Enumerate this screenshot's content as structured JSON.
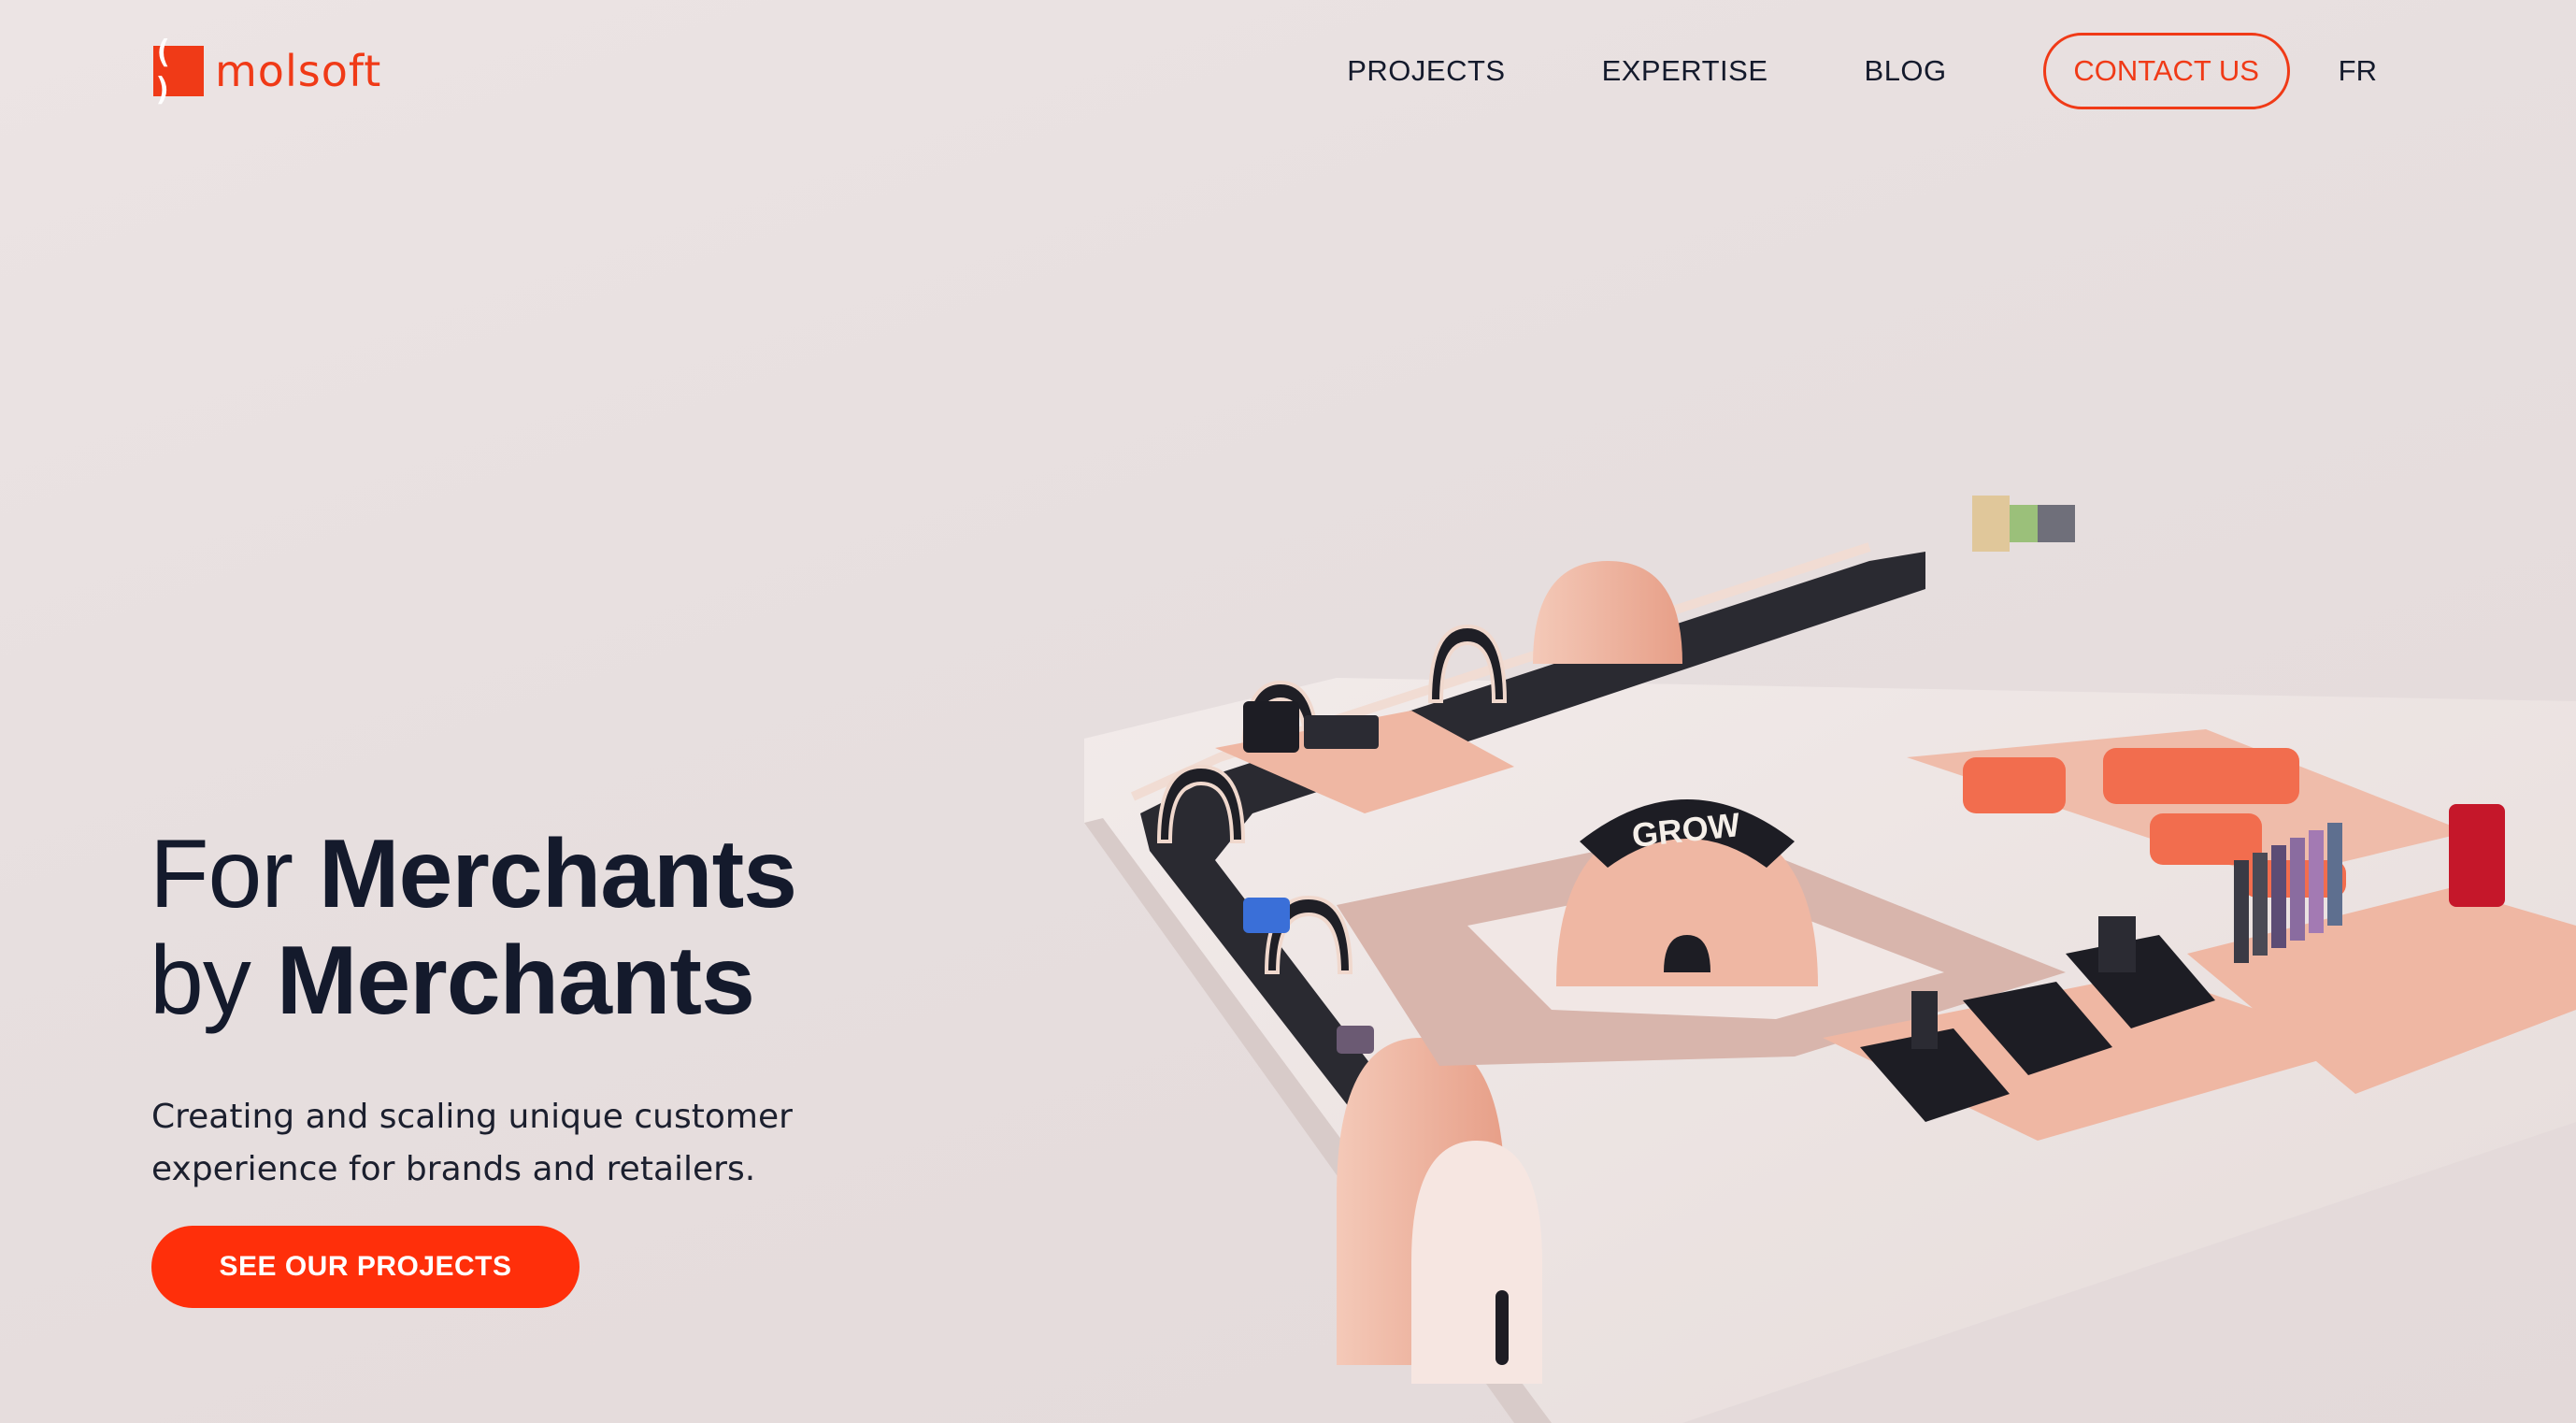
{
  "header": {
    "logo_mark": "( )",
    "logo_text": "molsoft",
    "nav": {
      "projects": "PROJECTS",
      "expertise": "EXPERTISE",
      "blog": "BLOG",
      "contact": "CONTACT US",
      "lang": "FR"
    }
  },
  "hero": {
    "line1_light": "For",
    "line1_bold": "Merchants",
    "line2_light": "by",
    "line2_bold": "Merchants",
    "subtitle_line1": "Creating and scaling unique customer",
    "subtitle_line2": "experience for brands and retailers.",
    "cta": "SEE OUR PROJECTS"
  },
  "illustration": {
    "sign_text": "GROW",
    "colors": {
      "accent": "#f03a17",
      "peach": "#efb7a3",
      "floor": "#efe6e4",
      "dark": "#1d1d24"
    }
  }
}
